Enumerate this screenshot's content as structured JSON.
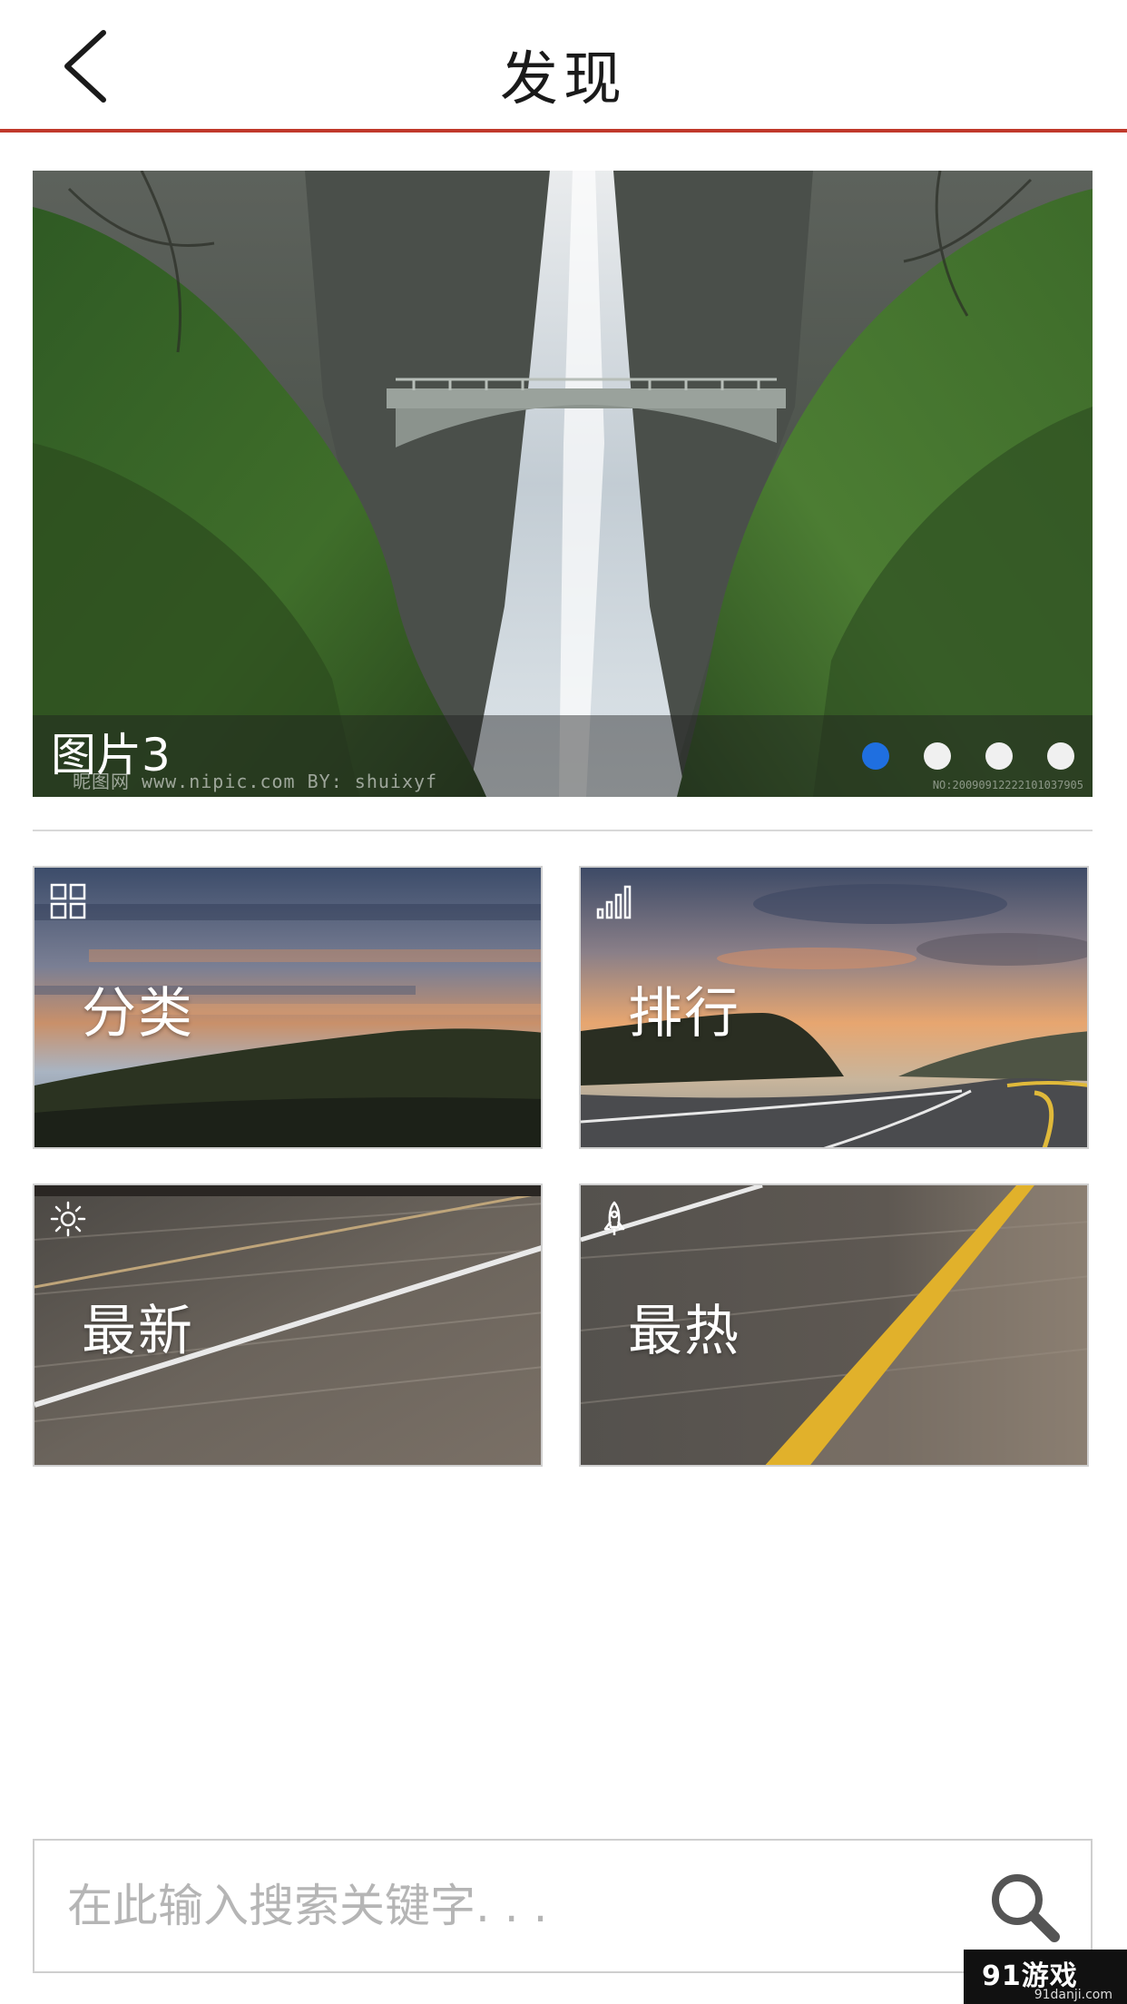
{
  "header": {
    "title": "发现",
    "back_icon": "chevron-left-icon"
  },
  "banner": {
    "caption": "图片3",
    "watermark": "昵图网 www.nipic.com  BY: shuixyf",
    "watermark_id": "NO:20090912222101037905",
    "slides_total": 4,
    "active_slide": 1
  },
  "tiles": [
    {
      "label": "分类",
      "icon": "grid-icon"
    },
    {
      "label": "排行",
      "icon": "bar-chart-icon"
    },
    {
      "label": "最新",
      "icon": "sun-icon"
    },
    {
      "label": "最热",
      "icon": "rocket-icon"
    }
  ],
  "search": {
    "placeholder": "在此输入搜索关键字. . .",
    "value": "",
    "icon": "search-icon"
  },
  "corner_logo": {
    "text": "91游戏",
    "url": "91danji.com"
  },
  "colors": {
    "accent_line": "#c0392b",
    "active_dot": "#1f6fe0",
    "inactive_dot": "#f0f0f0"
  }
}
